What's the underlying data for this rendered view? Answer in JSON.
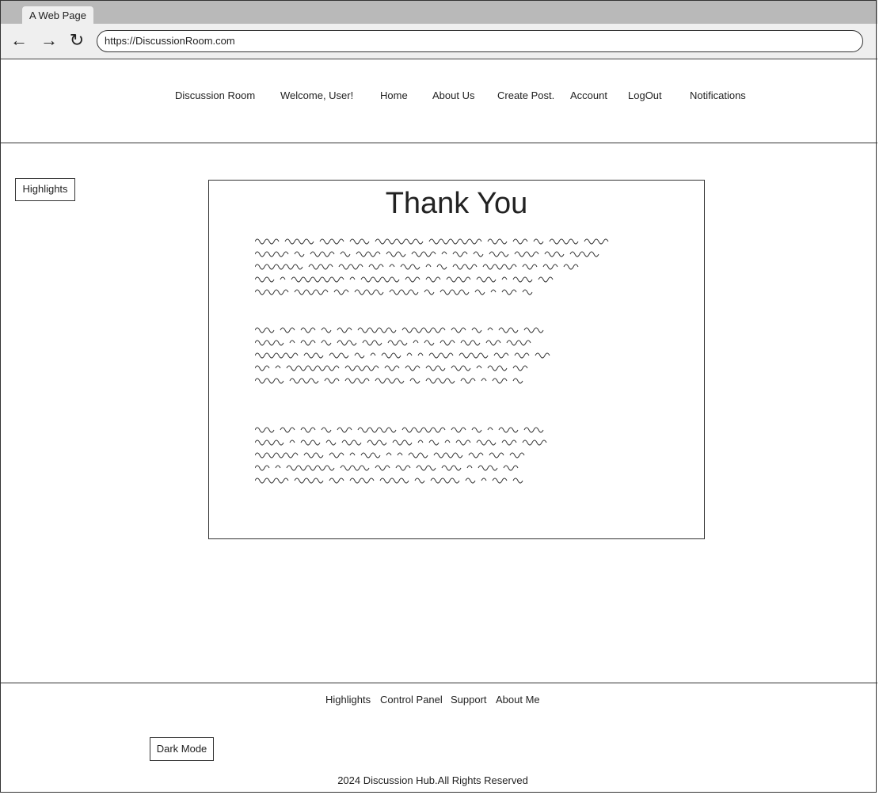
{
  "browser": {
    "tab_title": "A Web Page",
    "url": "https://DiscussionRoom.com"
  },
  "nav": {
    "brand": "Discussion Room",
    "welcome": "Welcome, User!",
    "home": "Home",
    "about": "About Us",
    "create": "Create Post.",
    "account": "Account",
    "logout": "LogOut",
    "notifications": "Notifications"
  },
  "sidebar": {
    "highlights_button": "Highlights"
  },
  "main": {
    "title": "Thank You"
  },
  "footer": {
    "links": [
      "Highlights",
      "Control Panel",
      "Support",
      "About Me"
    ],
    "dark_mode_button": "Dark Mode",
    "copyright": "2024 Discussion Hub.All Rights Reserved"
  }
}
